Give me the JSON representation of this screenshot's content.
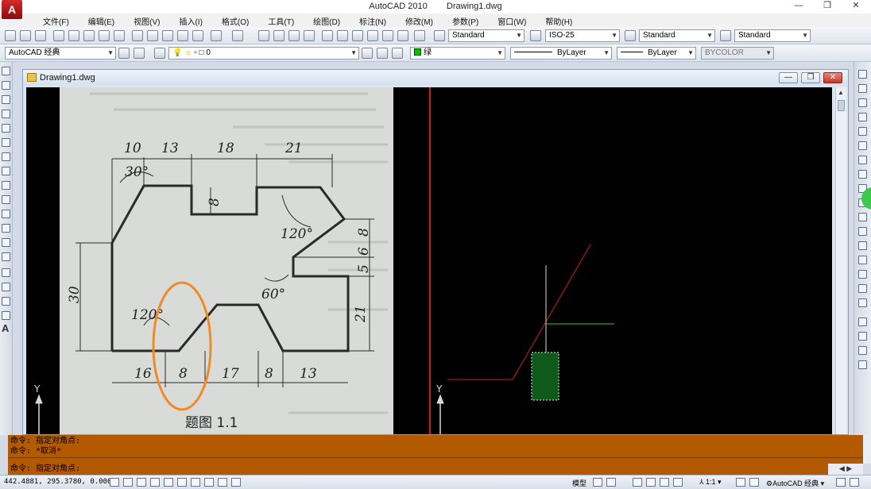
{
  "window": {
    "app_name": "AutoCAD 2010",
    "file_name": "Drawing1.dwg",
    "minimize": "—",
    "restore": "❐",
    "close": "✕"
  },
  "menu": [
    "文件(F)",
    "编辑(E)",
    "视图(V)",
    "插入(I)",
    "格式(O)",
    "工具(T)",
    "绘图(D)",
    "标注(N)",
    "修改(M)",
    "参数(P)",
    "窗口(W)",
    "帮助(H)"
  ],
  "toolbar": {
    "text_style": "Standard",
    "dim_style": "ISO-25",
    "table_style": "Standard",
    "multileader_style": "Standard",
    "workspace": "AutoCAD 经典",
    "layer": "0",
    "color": "绿",
    "linetype": "ByLayer",
    "lineweight": "ByLayer",
    "plot_style": "BYCOLOR"
  },
  "drawing_window": {
    "title": "Drawing1.dwg",
    "ucs_y_label": "Y"
  },
  "reference_image": {
    "dims_top": [
      "10",
      "13",
      "18",
      "21"
    ],
    "dims_bottom": [
      "16",
      "8",
      "17",
      "8",
      "13"
    ],
    "dims_right": [
      "8",
      "6",
      "5",
      "21"
    ],
    "dim_left": "30",
    "dim_inner": "8",
    "angles": [
      "30°",
      "120°",
      "60°",
      "120°"
    ],
    "caption": "题图 1.1"
  },
  "command": {
    "lines": [
      "命令: 指定对角点:",
      "命令: *取消*"
    ],
    "prompt": "命令: 指定对角点:"
  },
  "status": {
    "coords": "442.4881, 295.3780, 0.0000",
    "model_label": "模型",
    "annotation_scale": "1:1",
    "workspace_label": "AutoCAD 经典"
  },
  "colors": {
    "orange_ellipse": "#f08a24",
    "red_line": "#c8201c",
    "green_line": "#3cbf3c",
    "command_bg": "#b35a00"
  }
}
